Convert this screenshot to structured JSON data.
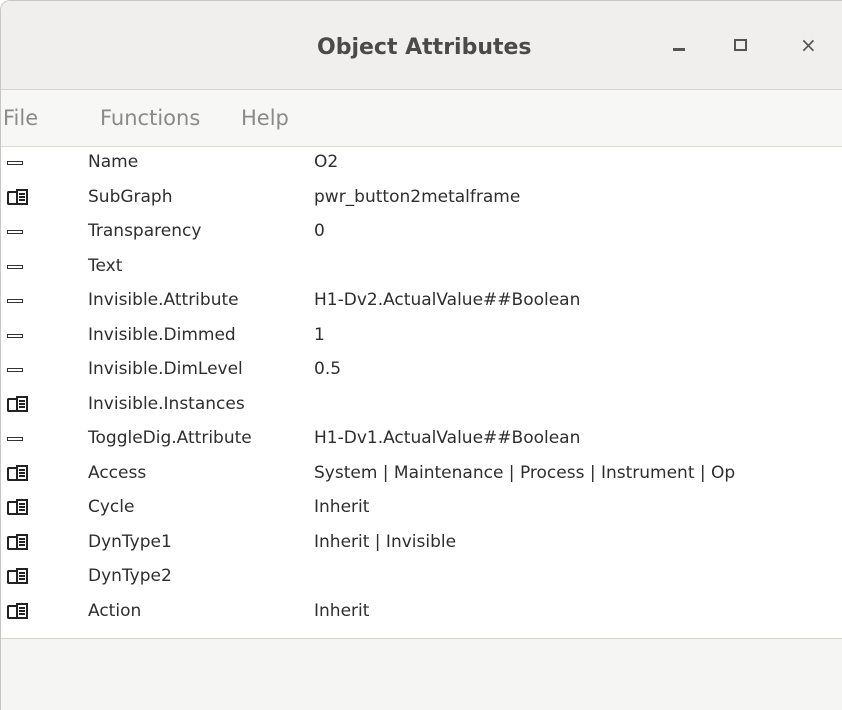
{
  "window": {
    "title": "Object Attributes"
  },
  "controls": {
    "minimize": "–",
    "maximize": "□",
    "close": "×"
  },
  "menu": {
    "file": "File",
    "functions": "Functions",
    "help": "Help"
  },
  "attributes": [
    {
      "icon": "dash-icon",
      "name": "Name",
      "value": "O2"
    },
    {
      "icon": "folder-icon",
      "name": "SubGraph",
      "value": "pwr_button2metalframe"
    },
    {
      "icon": "dash-icon",
      "name": "Transparency",
      "value": "0"
    },
    {
      "icon": "dash-icon",
      "name": "Text",
      "value": ""
    },
    {
      "icon": "dash-icon",
      "name": "Invisible.Attribute",
      "value": "H1-Dv2.ActualValue##Boolean"
    },
    {
      "icon": "dash-icon",
      "name": "Invisible.Dimmed",
      "value": "1"
    },
    {
      "icon": "dash-icon",
      "name": "Invisible.DimLevel",
      "value": "0.5"
    },
    {
      "icon": "folder-icon",
      "name": "Invisible.Instances",
      "value": ""
    },
    {
      "icon": "dash-icon",
      "name": "ToggleDig.Attribute",
      "value": "H1-Dv1.ActualValue##Boolean"
    },
    {
      "icon": "folder-icon",
      "name": "Access",
      "value": "System | Maintenance | Process | Instrument | Op"
    },
    {
      "icon": "folder-icon",
      "name": "Cycle",
      "value": "Inherit"
    },
    {
      "icon": "folder-icon",
      "name": "DynType1",
      "value": "Inherit | Invisible"
    },
    {
      "icon": "folder-icon",
      "name": "DynType2",
      "value": ""
    },
    {
      "icon": "folder-icon",
      "name": "Action",
      "value": "Inherit"
    }
  ]
}
